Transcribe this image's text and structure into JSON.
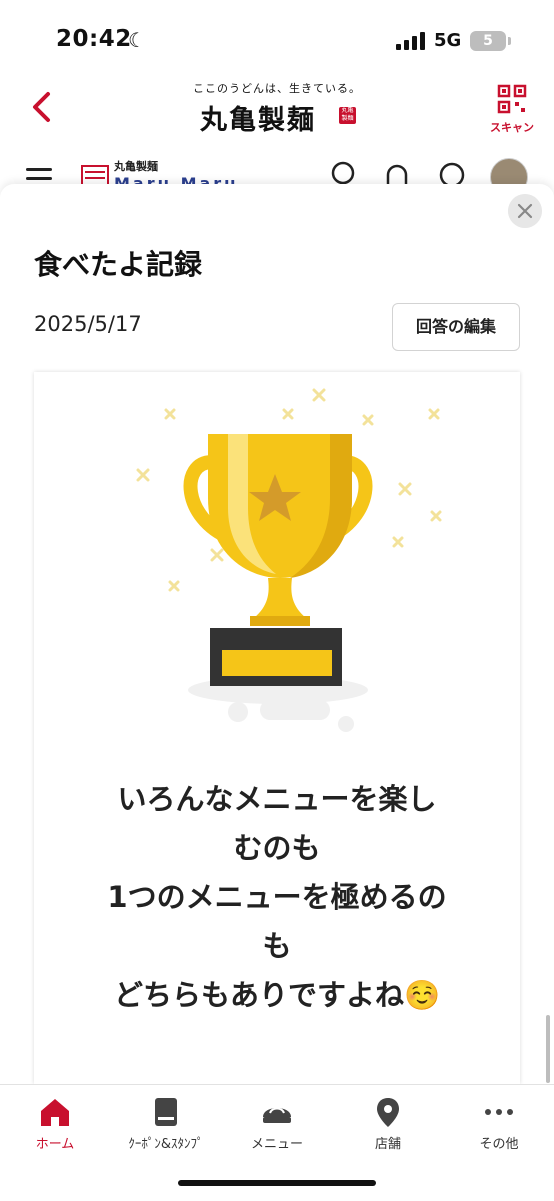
{
  "status_bar": {
    "time": "20:42",
    "network": "5G",
    "battery": "5"
  },
  "header": {
    "tagline": "ここのうどんは、生きている。",
    "logo": "丸亀製麺",
    "logo_seal": "丸亀製麺",
    "scan_label": "スキャン"
  },
  "nav": {
    "mini_logo_small": "丸亀製麺",
    "mini_logo_big": "Maru Maru"
  },
  "sheet": {
    "title": "食べたよ記録",
    "date": "2025/5/17",
    "edit_button": "回答の編集",
    "message_lines": [
      "いろんなメニューを楽し",
      "むのも",
      "1つのメニューを極めるの",
      "も",
      "どちらもありですよね☺️"
    ]
  },
  "tabbar": {
    "items": [
      {
        "label": "ホーム",
        "icon": "home-icon",
        "active": true
      },
      {
        "label": "ｸｰﾎﾟﾝ&ｽﾀﾝﾌﾟ",
        "icon": "coupon-icon",
        "active": false
      },
      {
        "label": "メニュー",
        "icon": "menu-bowl-icon",
        "active": false
      },
      {
        "label": "店舗",
        "icon": "location-pin-icon",
        "active": false
      },
      {
        "label": "その他",
        "icon": "more-icon",
        "active": false
      }
    ]
  },
  "colors": {
    "brand_red": "#c8102e",
    "trophy_gold": "#f5c518",
    "trophy_base": "#333333"
  }
}
